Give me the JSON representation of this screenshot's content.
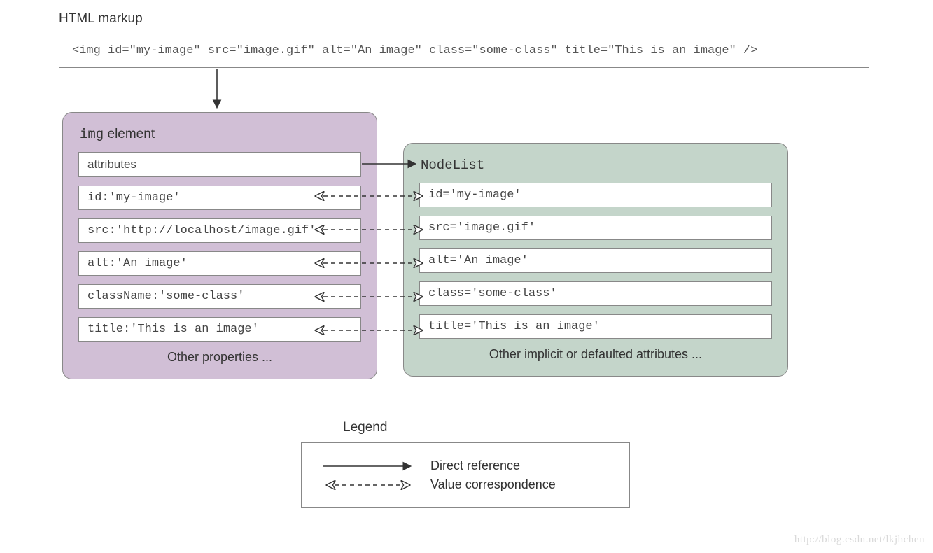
{
  "header": {
    "title": "HTML markup"
  },
  "markup": "<img id=\"my-image\" src=\"image.gif\" alt=\"An image\" class=\"some-class\" title=\"This is an image\" />",
  "element_panel": {
    "title_prefix": "img",
    "title_suffix": " element",
    "attributes_label": "attributes",
    "rows": [
      "id:'my-image'",
      "src:'http://localhost/image.gif'",
      "alt:'An image'",
      "className:'some-class'",
      "title:'This is an image'"
    ],
    "footer": "Other properties ..."
  },
  "nodelist_panel": {
    "title": "NodeList",
    "rows": [
      "id='my-image'",
      "src='image.gif'",
      "alt='An image'",
      "class='some-class'",
      "title='This is an image'"
    ],
    "footer": "Other implicit or defaulted attributes ..."
  },
  "legend": {
    "title": "Legend",
    "direct": "Direct reference",
    "value": "Value correspondence"
  },
  "watermark": "http://blog.csdn.net/lkjhchen",
  "colors": {
    "purple": "#d1bfd6",
    "green": "#c4d5ca",
    "border": "#888888"
  }
}
